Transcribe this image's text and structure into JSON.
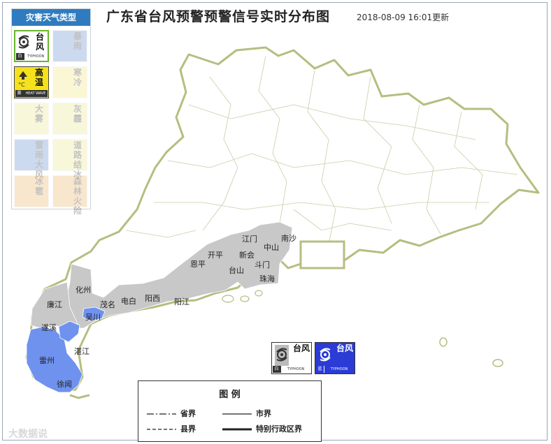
{
  "title": "广东省台风预警预警信号实时分布图",
  "timestamp": "2018-08-09 16:01更新",
  "panel": {
    "header": "灾害天气类型",
    "items": [
      {
        "cn": "台风",
        "level": "白",
        "en": "TYPHOON",
        "state": "selected",
        "icon": "typhoon-icon"
      },
      {
        "cn": "暴雨",
        "level": "",
        "en": "",
        "state": "inactive",
        "icon": "rainstorm-icon"
      },
      {
        "cn": "高温",
        "level": "黄",
        "en": "HEAT WAVE",
        "state": "active",
        "icon": "heat-icon"
      },
      {
        "cn": "寒冷",
        "level": "",
        "en": "",
        "state": "inactive",
        "icon": "cold-icon"
      },
      {
        "cn": "大雾",
        "level": "",
        "en": "",
        "state": "inactive",
        "icon": "fog-icon"
      },
      {
        "cn": "灰霾",
        "level": "",
        "en": "",
        "state": "inactive",
        "icon": "haze-icon"
      },
      {
        "cn": "雷雨大风",
        "level": "",
        "en": "",
        "state": "inactive",
        "icon": "thunder-icon"
      },
      {
        "cn": "道路结冰",
        "level": "",
        "en": "",
        "state": "inactive",
        "icon": "ice-icon"
      },
      {
        "cn": "冰雹",
        "level": "",
        "en": "",
        "state": "inactive",
        "icon": "hail-icon"
      },
      {
        "cn": "森林火险",
        "level": "",
        "en": "",
        "state": "inactive",
        "icon": "fire-icon"
      }
    ]
  },
  "map_labels": [
    "化州",
    "廉江",
    "茂名",
    "电白",
    "阳西",
    "阳江",
    "遂溪",
    "吴川",
    "湛江",
    "雷州",
    "徐闻",
    "恩平",
    "开平",
    "台山",
    "新会",
    "江门",
    "中山",
    "斗门",
    "珠海",
    "南沙"
  ],
  "badges": [
    {
      "cn": "台风",
      "level": "白",
      "en": "TYPHOON",
      "color": "#ffffff"
    },
    {
      "cn": "台风",
      "level": "蓝",
      "en": "TYPHOON",
      "color": "#2a3bd6"
    }
  ],
  "colors": {
    "warning_white": "#c8c8c8",
    "warning_blue": "#6f92ee",
    "province_border": "#b7bd80"
  },
  "legend": {
    "title": "图 例",
    "province": "省界",
    "city": "市界",
    "county": "县界",
    "sar": "特别行政区界"
  },
  "watermark": "大数据说"
}
